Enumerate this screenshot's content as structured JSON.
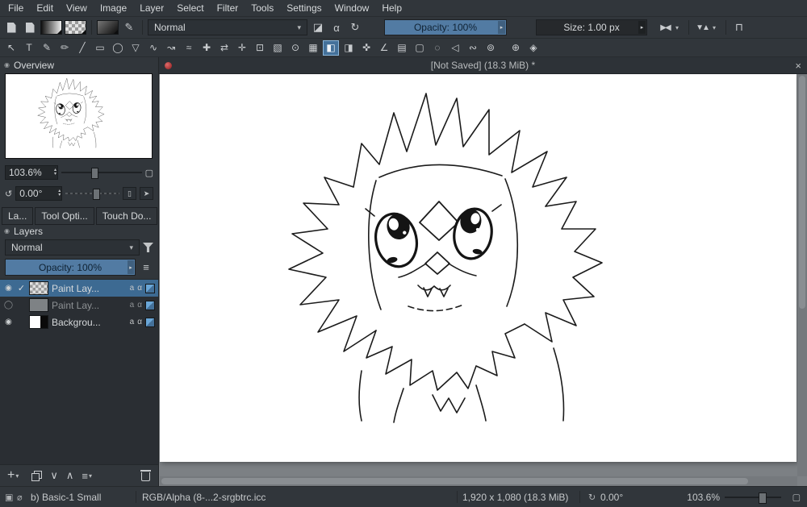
{
  "icons": {
    "caret_down": "▾",
    "spin_up": "▴",
    "spin_down": "▾",
    "hamburger": "≡",
    "docker_circle": "◉",
    "spinner": "▸"
  },
  "menubar": {
    "items": [
      "File",
      "Edit",
      "View",
      "Image",
      "Layer",
      "Select",
      "Filter",
      "Tools",
      "Settings",
      "Window",
      "Help"
    ]
  },
  "toolbar1": {
    "blend_mode": "Normal",
    "opacity": "Opacity: 100%",
    "size": "Size: 1.00 px",
    "eraser_glyph": "◪",
    "preserve_alpha_glyph": "α",
    "reload_glyph": "↻",
    "mirror_h_glyph": "▶◀",
    "mirror_v_glyph": "▼▲",
    "wrap_glyph": "⊓"
  },
  "toolbar2": {
    "tools": [
      {
        "name": "tool-select-shapes",
        "glyph": "↖"
      },
      {
        "name": "tool-text",
        "glyph": "T"
      },
      {
        "name": "tool-edit-shapes",
        "glyph": "✎"
      },
      {
        "name": "tool-calligraphy",
        "glyph": "✏"
      },
      {
        "name": "tool-line",
        "glyph": "╱"
      },
      {
        "name": "tool-rectangle",
        "glyph": "▭"
      },
      {
        "name": "tool-ellipse",
        "glyph": "◯"
      },
      {
        "name": "tool-polygon",
        "glyph": "▽"
      },
      {
        "name": "tool-polyline",
        "glyph": "∿"
      },
      {
        "name": "tool-bezier",
        "glyph": "↝"
      },
      {
        "name": "tool-freehand-path",
        "glyph": "≈"
      },
      {
        "name": "tool-multibrush",
        "glyph": "✚"
      },
      {
        "name": "tool-transform",
        "glyph": "⇄"
      },
      {
        "name": "tool-move",
        "glyph": "✛"
      },
      {
        "name": "tool-crop",
        "glyph": "⊡"
      },
      {
        "name": "tool-gradient",
        "glyph": "▧"
      },
      {
        "name": "tool-color-sampler",
        "glyph": "⊙"
      },
      {
        "name": "tool-pattern",
        "glyph": "▦"
      },
      {
        "name": "tool-fill",
        "glyph": "◧",
        "active": true
      },
      {
        "name": "tool-enclose-fill",
        "glyph": "◨"
      },
      {
        "name": "tool-assistants",
        "glyph": "✜"
      },
      {
        "name": "tool-measure",
        "glyph": "∠"
      },
      {
        "name": "tool-reference-images",
        "glyph": "▤"
      },
      {
        "name": "tool-select-rectangular",
        "glyph": "▢"
      },
      {
        "name": "tool-select-elliptical",
        "glyph": "◌"
      },
      {
        "name": "tool-select-polygonal",
        "glyph": "◁"
      },
      {
        "name": "tool-select-freehand",
        "glyph": "∾"
      },
      {
        "name": "tool-select-contiguous",
        "glyph": "⊚"
      },
      {
        "name": "tool-zoom",
        "glyph": "⊕",
        "sep_before": true
      },
      {
        "name": "tool-pan",
        "glyph": "◈"
      }
    ]
  },
  "overview": {
    "title": "Overview",
    "zoom": "103.6%",
    "rotation": "0.00°",
    "rotate_icon": "↺",
    "monitor_icon": "▢",
    "mirror_btn": "▯",
    "pin_btn": "➤"
  },
  "docker_tabs": {
    "tabs": [
      {
        "label": "La..."
      },
      {
        "label": "Tool Opti..."
      },
      {
        "label": "Touch Do..."
      }
    ]
  },
  "layers_docker": {
    "title": "Layers",
    "blend_mode": "Normal",
    "opacity": "Opacity: 100%",
    "rows": [
      {
        "name": "Paint Lay...",
        "eye": "◉",
        "check": "✓",
        "thumb": "checker",
        "selected": true,
        "badge_a": "a",
        "badge_alpha": "α"
      },
      {
        "name": "Paint Lay...",
        "eye": "◯",
        "check": "",
        "thumb": "gray",
        "dim": true,
        "badge_a": "a",
        "badge_alpha": "α"
      },
      {
        "name": "Backgrou...",
        "eye": "◉",
        "check": "",
        "thumb": "bw",
        "badge_a": "a",
        "badge_alpha": "α"
      }
    ],
    "buttons": {
      "add": "+",
      "down": "∨",
      "up": "∧",
      "props": "≡"
    }
  },
  "document": {
    "title": "[Not Saved]  (18.3 MiB) *",
    "close_glyph": "×"
  },
  "statusbar": {
    "brush": "b) Basic-1 Small",
    "profile": "RGB/Alpha (8-...2-srgbtrc.icc",
    "dims": "1,920 x 1,080 (18.3 MiB)",
    "angle": "0.00°",
    "angle_icon": "↻",
    "zoom": "103.6%",
    "mem_icon": "▣",
    "selection_icon": "⌀",
    "canvas_icon": "▢"
  },
  "colors": {
    "accent_blue": "#527ba3",
    "selected_layer": "#3d6a92",
    "tool_active": "#44719a",
    "canvas_gray": "#7c8084",
    "panel_bg": "#31363b"
  }
}
